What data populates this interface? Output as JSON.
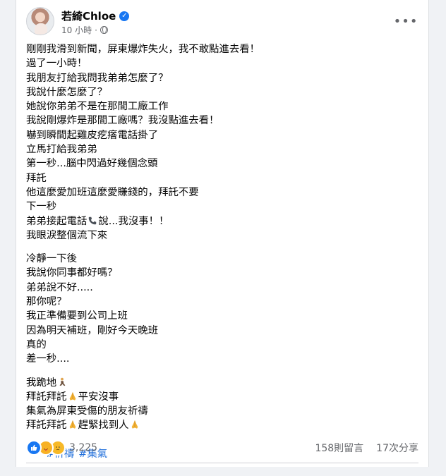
{
  "post": {
    "author": "若綺Chloe",
    "timestamp": "10 小時",
    "meta_separator": "·",
    "more_label": "•••",
    "lines_block1": [
      "剛剛我滑到新聞，屏東爆炸失火，我不敢點進去看！",
      "過了一小時！",
      "我朋友打給我問我弟弟怎麼了？",
      "我說什麼怎麼了？",
      "她說你弟弟不是在那間工廠工作",
      "我說剛爆炸是那間工廠嗎？我沒點進去看！",
      "嚇到瞬間起雞皮疙瘩電話掛了",
      "立馬打給我弟弟",
      "第一秒...腦中閃過好幾個念頭",
      "拜託",
      "他這麼愛加班這麼愛賺錢的，拜託不要",
      "下一秒"
    ],
    "line_phone_before": "弟弟接起電話",
    "line_phone_after": "說...我沒事！！",
    "line_tears": "我眼淚整個流下來",
    "lines_block2": [
      "冷靜一下後",
      "我說你同事都好嗎？",
      "弟弟說不好.....",
      "那你呢？",
      "我正準備要到公司上班",
      "因為明天補班，剛好今天晚班",
      "真的",
      "差一秒...."
    ],
    "kneel_line": "我跪地",
    "pray_line1_a": "拜託拜託",
    "pray_line1_b": "平安沒事",
    "pray_line2": "集氣為屏東受傷的朋友祈禱",
    "pray_line3_a": "拜託拜託",
    "pray_line3_b": "趕緊找到人",
    "hashtags": [
      "#祈禱",
      "#集氣"
    ]
  },
  "footer": {
    "reaction_count": "3,225",
    "comments": "158則留言",
    "shares": "17次分享"
  },
  "icons": {
    "verified": "verified-badge-icon",
    "privacy": "globe-icon",
    "reactions": [
      "like-icon",
      "care-icon",
      "sad-icon"
    ],
    "phone": "phone-icon",
    "pray": "folded-hands-icon",
    "kneel": "kneeling-person-icon"
  },
  "colors": {
    "link": "#216fdb",
    "verified": "#1877f2",
    "meta": "#65676b"
  }
}
